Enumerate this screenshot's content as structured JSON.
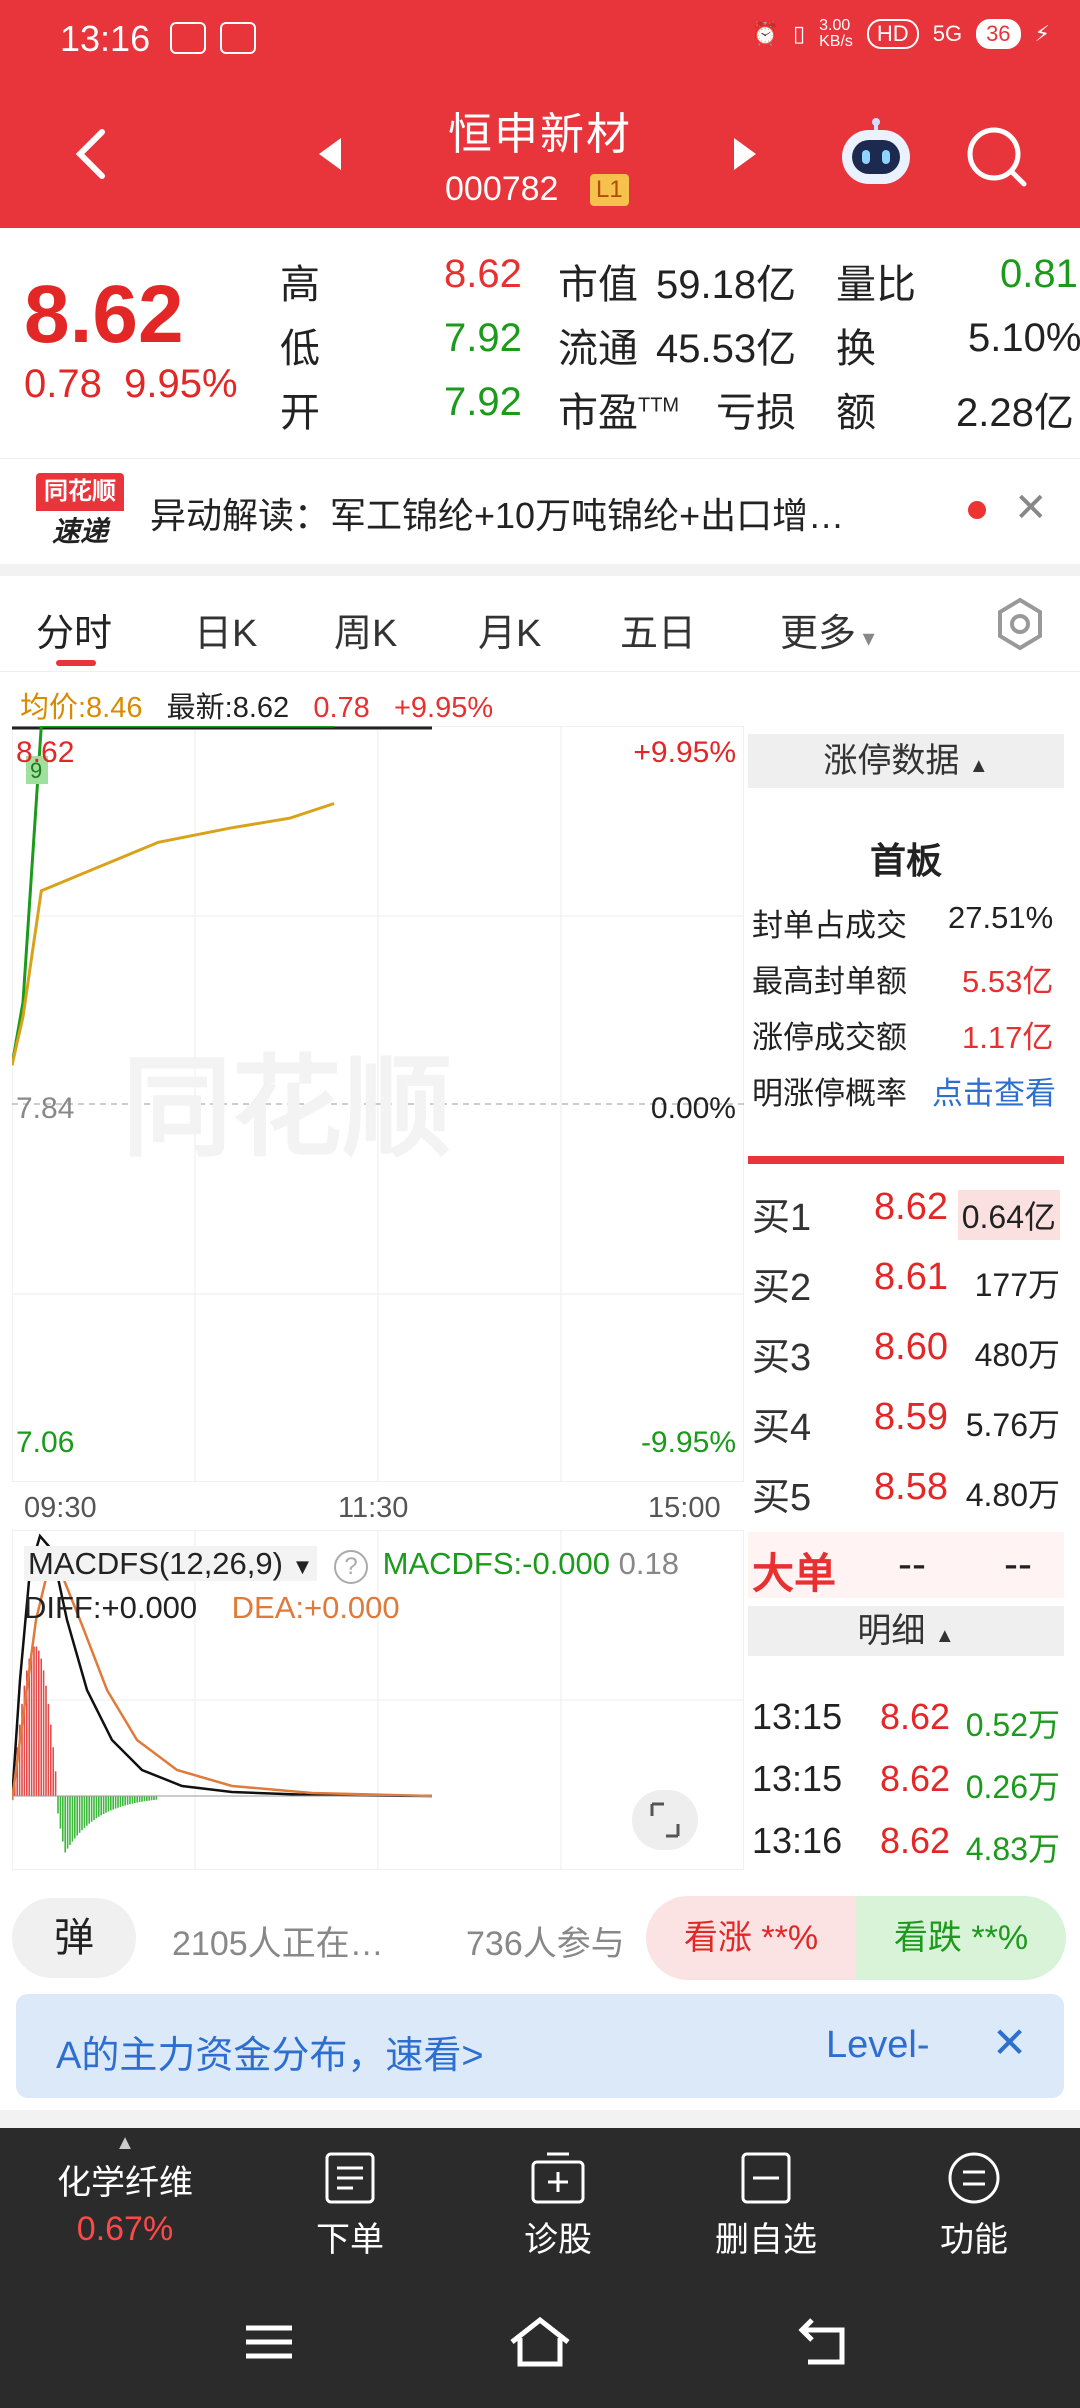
{
  "status": {
    "time": "13:16",
    "net_speed": "3.00\nKB/s",
    "hd": "HD",
    "signal": "5G",
    "battery": "36"
  },
  "header": {
    "title": "恒申新材",
    "code": "000782",
    "level": "L1"
  },
  "quote": {
    "price": "8.62",
    "change": "0.78",
    "change_pct": "9.95%",
    "high_label": "高",
    "high": "8.62",
    "low_label": "低",
    "low": "7.92",
    "open_label": "开",
    "open": "7.92",
    "mktcap_label": "市值",
    "mktcap": "59.18亿",
    "float_label": "流通",
    "float": "45.53亿",
    "pe_label": "市盈",
    "pe_sup": "TTM",
    "pe": "亏损",
    "volratio_label": "量比",
    "volratio": "0.81",
    "turnover_label": "换",
    "turnover": "5.10%",
    "amount_label": "额",
    "amount": "2.28亿"
  },
  "news": {
    "logo_top": "同花顺",
    "logo_bottom": "速递",
    "text": "异动解读：军工锦纶+10万吨锦纶+出口增…"
  },
  "tabs": [
    "分时",
    "日K",
    "周K",
    "月K",
    "五日",
    "更多"
  ],
  "chart_info": {
    "avg_label": "均价:8.46",
    "latest_label": "最新:8.62",
    "change": "0.78",
    "change_pct": "+9.95%"
  },
  "price_axis": {
    "top": "8.62",
    "mid": "7.84",
    "bottom": "7.06",
    "top_pct": "+9.95%",
    "mid_pct": "0.00%",
    "bottom_pct": "-9.95%"
  },
  "time_axis": [
    "09:30",
    "11:30",
    "15:00"
  ],
  "watermark": "同花顺",
  "macd": {
    "name": "MACDFS(12,26,9)",
    "macdfs": "MACDFS:-0.000",
    "value": "0.18",
    "diff": "DIFF:+0.000",
    "dea": "DEA:+0.000"
  },
  "limit_panel": {
    "title": "涨停数据",
    "board": "首板",
    "rows": [
      {
        "label": "封单占成交",
        "value": "27.51%"
      },
      {
        "label": "最高封单额",
        "value": "5.53亿"
      },
      {
        "label": "涨停成交额",
        "value": "1.17亿"
      },
      {
        "label": "明涨停概率",
        "value": "点击查看"
      }
    ]
  },
  "order_book": [
    {
      "label": "买1",
      "price": "8.62",
      "vol": "0.64亿"
    },
    {
      "label": "买2",
      "price": "8.61",
      "vol": "177万"
    },
    {
      "label": "买3",
      "price": "8.60",
      "vol": "480万"
    },
    {
      "label": "买4",
      "price": "8.59",
      "vol": "5.76万"
    },
    {
      "label": "买5",
      "price": "8.58",
      "vol": "4.80万"
    }
  ],
  "big_order": {
    "label": "大单",
    "v1": "--",
    "v2": "--"
  },
  "detail": {
    "title": "明细",
    "ticks": [
      {
        "time": "13:15",
        "price": "8.62",
        "vol": "0.52万"
      },
      {
        "time": "13:15",
        "price": "8.62",
        "vol": "0.26万"
      },
      {
        "time": "13:16",
        "price": "8.62",
        "vol": "4.83万"
      }
    ]
  },
  "comment_bar": {
    "danmu": "弹",
    "watching": "2105人正在…",
    "participants": "736人参与",
    "bull": "看涨 **%",
    "bear": "看跌 **%"
  },
  "banner": {
    "text": "A的主力资金分布，速看>",
    "right": "Level-"
  },
  "toolbar": {
    "sector_name": "化学纤维",
    "sector_pct": "0.67%",
    "items": [
      "下单",
      "诊股",
      "删自选",
      "功能"
    ]
  },
  "colors": {
    "brand_red": "#e8343b",
    "up": "#e32727",
    "down": "#1b9a1b",
    "avg_line": "#d9a21b"
  },
  "chart_data": {
    "type": "line",
    "series": [
      {
        "values": [
          7.92,
          8.05,
          8.62,
          8.62,
          8.62,
          8.62,
          8.62,
          8.62
        ]
      },
      {
        "values": [
          7.92,
          8.02,
          8.28,
          8.33,
          8.38,
          8.41,
          8.43,
          8.46
        ]
      }
    ],
    "ylim": [
      7.06,
      8.62
    ]
  }
}
